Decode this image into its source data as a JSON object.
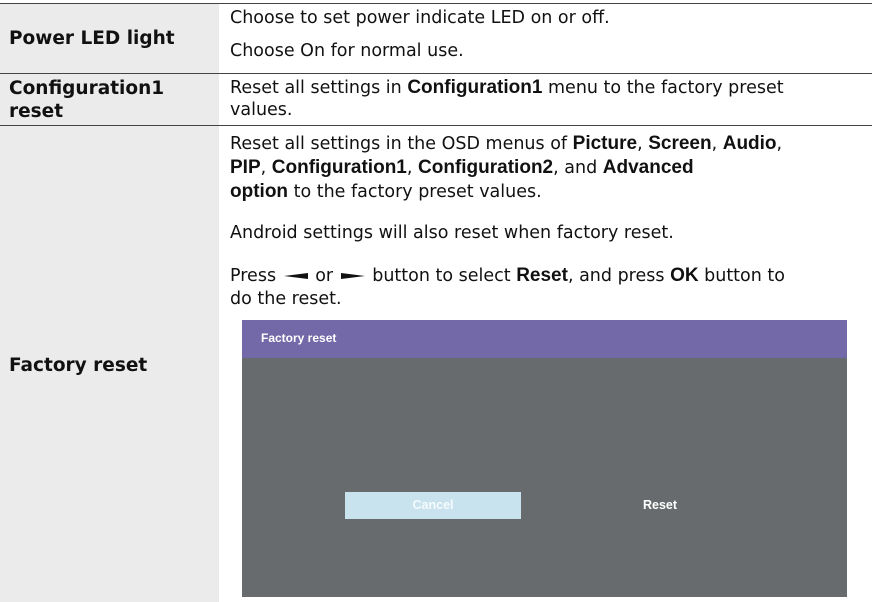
{
  "rows": [
    {
      "label": "Power LED light",
      "lines": [
        "Choose to set power indicate LED on or off.",
        "Choose On for normal use."
      ]
    },
    {
      "label_line1": "Configuration1",
      "label_line2": "reset",
      "desc": {
        "t1": "Reset all settings in ",
        "b1": "Configuration1",
        "t2": " menu to the factory preset",
        "t3": "values."
      }
    },
    {
      "label": "Factory reset",
      "para1": {
        "t1": "Reset all settings in the OSD menus of ",
        "b1": "Picture",
        "s1": ", ",
        "b2": "Screen",
        "s2": ", ",
        "b3": "Audio",
        "s3": ",",
        "b4": "PIP",
        "s4": ", ",
        "b5": "Configuration1",
        "s5": ", ",
        "b6": "Configuration2",
        "s6": ", and ",
        "b7": "Advanced",
        "b8": "option",
        "t2": " to the factory preset values."
      },
      "para2": "Android settings will also reset when factory reset.",
      "para3": {
        "t1": "Press ",
        "t2": " or ",
        "t3": " button to select ",
        "b1": "Reset",
        "t4": ", and press ",
        "b2": "OK",
        "t5": " button to",
        "t6": "do the reset."
      }
    }
  ],
  "osd": {
    "title": "Factory reset",
    "cancel_label": "Cancel",
    "reset_label": "Reset"
  },
  "colors": {
    "label_bg": "#ebebeb",
    "osd_title_bar": "#7369a8",
    "osd_body": "#686b6d",
    "cancel_bg": "#c8e2ee"
  },
  "icons": [
    "left-arrow-icon",
    "right-arrow-icon"
  ]
}
